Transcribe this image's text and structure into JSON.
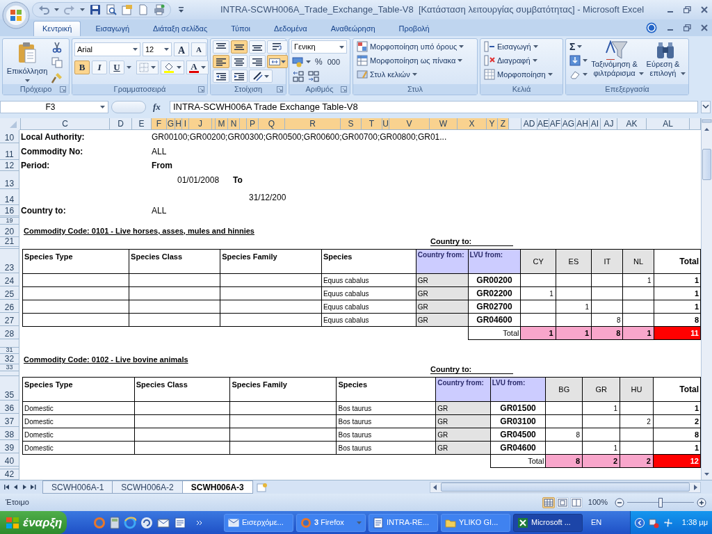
{
  "window": {
    "title": "INTRA-SCWH006A_Trade_Exchange_Table-V8  [Κατάσταση λειτουργίας συμβατότητας] - Microsoft Excel"
  },
  "ribbon_tabs": [
    {
      "label": "Κεντρική",
      "selected": true
    },
    {
      "label": "Εισαγωγή",
      "selected": false
    },
    {
      "label": "Διάταξη σελίδας",
      "selected": false
    },
    {
      "label": "Τύποι",
      "selected": false
    },
    {
      "label": "Δεδομένα",
      "selected": false
    },
    {
      "label": "Αναθεώρηση",
      "selected": false
    },
    {
      "label": "Προβολή",
      "selected": false
    }
  ],
  "ribbon": {
    "clipboard": {
      "paste": "Επικόλληση",
      "label": "Πρόχειρο"
    },
    "font": {
      "name": "Arial",
      "size": "12",
      "grow": "A",
      "shrink": "A",
      "bold": {
        "text": "B",
        "on": true
      },
      "italic": {
        "text": "I",
        "on": false
      },
      "underline": {
        "text": "U",
        "on": false
      },
      "font_color": "A",
      "label": "Γραμματοσειρά"
    },
    "alignment": {
      "vertical": [
        {
          "selected": false
        },
        {
          "selected": true
        },
        {
          "selected": false
        }
      ],
      "horizontal": [
        {
          "selected": true
        },
        {
          "selected": false
        },
        {
          "selected": false
        }
      ],
      "wrap_text": false,
      "merge_center": true,
      "label": "Στοίχιση"
    },
    "number": {
      "format": "Γενικη",
      "percent": "%",
      "thousands": "000",
      "label": "Αριθμός"
    },
    "styles": {
      "items": [
        "Μορφοποίηση υπό όρους",
        "Μορφοποίηση ως πίνακα",
        "Στυλ κελιών"
      ],
      "label": "Στυλ"
    },
    "cells": {
      "items": [
        "Εισαγωγή",
        "Διαγραφή",
        "Μορφοποίηση"
      ],
      "label": "Κελιά"
    },
    "editing": {
      "autosum": "Σ",
      "sort": "Ταξινόμηση & φιλτράρισμα",
      "find": "Εύρεση & επιλογή",
      "label": "Επεξεργασία"
    }
  },
  "formula_bar": {
    "name_box": "F3",
    "fx": "fx",
    "value": "INTRA-SCWH006A Trade Exchange Table-V8"
  },
  "columns": [
    {
      "selected": false
    },
    {
      "label": "C",
      "selected": false
    },
    {
      "label": "D",
      "selected": false
    },
    {
      "label": "E",
      "selected": false
    },
    {
      "label": "F",
      "selected": true
    },
    {
      "label": "G",
      "selected": true
    },
    {
      "label": "H",
      "selected": true
    },
    {
      "label": "I",
      "selected": true
    },
    {
      "label": "J",
      "selected": true
    },
    {
      "selected": true
    },
    {
      "label": "M",
      "selected": true
    },
    {
      "label": "N",
      "selected": true
    },
    {
      "selected": true
    },
    {
      "label": "P",
      "selected": true
    },
    {
      "label": "Q",
      "selected": true
    },
    {
      "label": "R",
      "selected": true
    },
    {
      "label": "S",
      "selected": true
    },
    {
      "label": "T",
      "selected": true
    },
    {
      "label": "U",
      "selected": true
    },
    {
      "label": "V",
      "selected": true
    },
    {
      "label": "W",
      "selected": true
    },
    {
      "label": "X",
      "selected": true
    },
    {
      "label": "Y",
      "selected": true
    },
    {
      "label": "Z",
      "selected": true
    },
    {
      "selected": false
    },
    {
      "label": "AD",
      "selected": false
    },
    {
      "label": "AE",
      "selected": false
    },
    {
      "label": "AF",
      "selected": false
    },
    {
      "label": "AG",
      "selected": false
    },
    {
      "label": "AH",
      "selected": false
    },
    {
      "label": "AI",
      "selected": false
    },
    {
      "label": "AJ",
      "selected": false
    },
    {
      "label": "AK",
      "selected": false
    },
    {
      "label": "AL",
      "selected": false
    },
    {
      "selected": false
    }
  ],
  "row_numbers": [
    "10",
    "11",
    "12",
    "13",
    "14",
    "16",
    "19",
    "20",
    "21",
    "23",
    "24",
    "25",
    "26",
    "27",
    "28",
    "31",
    "32",
    "33",
    "35",
    "36",
    "37",
    "38",
    "39",
    "40",
    "42"
  ],
  "report": {
    "local_authority": {
      "label": "Local Authority:",
      "value": "GR00100;GR00200;GR00300;GR00500;GR00600;GR00700;GR00800;GR01..."
    },
    "commodity_no": {
      "label": "Commodity No:",
      "value": "ALL"
    },
    "period": {
      "label": "Period:",
      "from_label": "From",
      "from": "01/01/2008",
      "to_label": "To",
      "to": "31/12/200"
    },
    "country_to": {
      "label": "Country to:",
      "value": "ALL"
    }
  },
  "sections": [
    {
      "title": "Commodity Code: 0101 - Live horses, asses, mules and hinnies",
      "country_to_label": "Country to:",
      "columns": [
        "Species Type",
        "Species Class",
        "Species Family",
        "Species",
        "Country from:",
        "LVU from:"
      ],
      "countries": [
        "CY",
        "ES",
        "IT",
        "NL"
      ],
      "total_label": "Total",
      "rows": [
        {
          "species": "Equus cabalus",
          "country_from": "GR",
          "lvu": "GR00200",
          "cells": [
            {
              "kind": "empty"
            },
            {
              "kind": "empty"
            },
            {
              "kind": "empty"
            },
            {
              "kind": "count",
              "value": "1"
            }
          ],
          "total": "1"
        },
        {
          "species": "Equus cabalus",
          "country_from": "GR",
          "lvu": "GR02200",
          "cells": [
            {
              "kind": "count",
              "value": "1"
            },
            {
              "kind": "empty"
            },
            {
              "kind": "empty"
            },
            {
              "kind": "empty"
            }
          ],
          "total": "1"
        },
        {
          "species": "Equus cabalus",
          "country_from": "GR",
          "lvu": "GR02700",
          "cells": [
            {
              "kind": "empty"
            },
            {
              "kind": "count",
              "value": "1"
            },
            {
              "kind": "empty"
            },
            {
              "kind": "empty"
            }
          ],
          "total": "1"
        },
        {
          "species": "Equus cabalus",
          "country_from": "GR",
          "lvu": "GR04600",
          "cells": [
            {
              "kind": "empty"
            },
            {
              "kind": "empty"
            },
            {
              "kind": "count",
              "value": "8"
            },
            {
              "kind": "empty"
            }
          ],
          "total": "8"
        }
      ],
      "totals": {
        "label": "Total",
        "counts": [
          "1",
          "1",
          "8",
          "1"
        ],
        "total": "11"
      }
    },
    {
      "title": "Commodity Code: 0102 - Live bovine animals",
      "country_to_label": "Country to:",
      "columns": [
        "Species Type",
        "Species Class",
        "Species Family",
        "Species",
        "Country from:",
        "LVU from:"
      ],
      "countries": [
        "BG",
        "GR",
        "HU"
      ],
      "total_label": "Total",
      "rows": [
        {
          "species_type": "Domestic",
          "species": "Bos taurus",
          "country_from": "GR",
          "lvu": "GR01500",
          "cells": [
            {
              "kind": "empty"
            },
            {
              "kind": "count",
              "value": "1"
            },
            {
              "kind": "empty"
            }
          ],
          "total": "1"
        },
        {
          "species_type": "Domestic",
          "species": "Bos taurus",
          "country_from": "GR",
          "lvu": "GR03100",
          "cells": [
            {
              "kind": "empty"
            },
            {
              "kind": "empty"
            },
            {
              "kind": "count",
              "value": "2"
            }
          ],
          "total": "2"
        },
        {
          "species_type": "Domestic",
          "species": "Bos taurus",
          "country_from": "GR",
          "lvu": "GR04500",
          "cells": [
            {
              "kind": "count",
              "value": "8"
            },
            {
              "kind": "empty"
            },
            {
              "kind": "empty"
            }
          ],
          "total": "8"
        },
        {
          "species_type": "Domestic",
          "species": "Bos taurus",
          "country_from": "GR",
          "lvu": "GR04600",
          "cells": [
            {
              "kind": "empty"
            },
            {
              "kind": "count",
              "value": "1"
            },
            {
              "kind": "empty"
            }
          ],
          "total": "1"
        }
      ],
      "totals": {
        "label": "Total",
        "counts": [
          "8",
          "2",
          "2"
        ],
        "total": "12"
      }
    }
  ],
  "sheet_tabs": [
    {
      "label": "SCWH006A-1",
      "selected": false
    },
    {
      "label": "SCWH006A-2",
      "selected": false
    },
    {
      "label": "SCWH006A-3",
      "selected": true
    }
  ],
  "status_bar": {
    "text": "Έτοιμο",
    "views": [
      {
        "selected": true
      },
      {
        "selected": false
      },
      {
        "selected": false
      }
    ],
    "zoom": {
      "label": "100%",
      "level": 0.5
    }
  },
  "taskbar": {
    "start": "έναρξη",
    "tasks": [
      {
        "label": "Εισερχόμε...",
        "selected": false
      },
      {
        "label": "**3** Firefox",
        "selected": false
      },
      {
        "label": "INTRA-RE...",
        "selected": false
      },
      {
        "label": "YLIKO GI...",
        "selected": false
      },
      {
        "label": "Microsoft ...",
        "selected": true
      }
    ],
    "language": "EN",
    "clock": "1:38 μμ"
  }
}
